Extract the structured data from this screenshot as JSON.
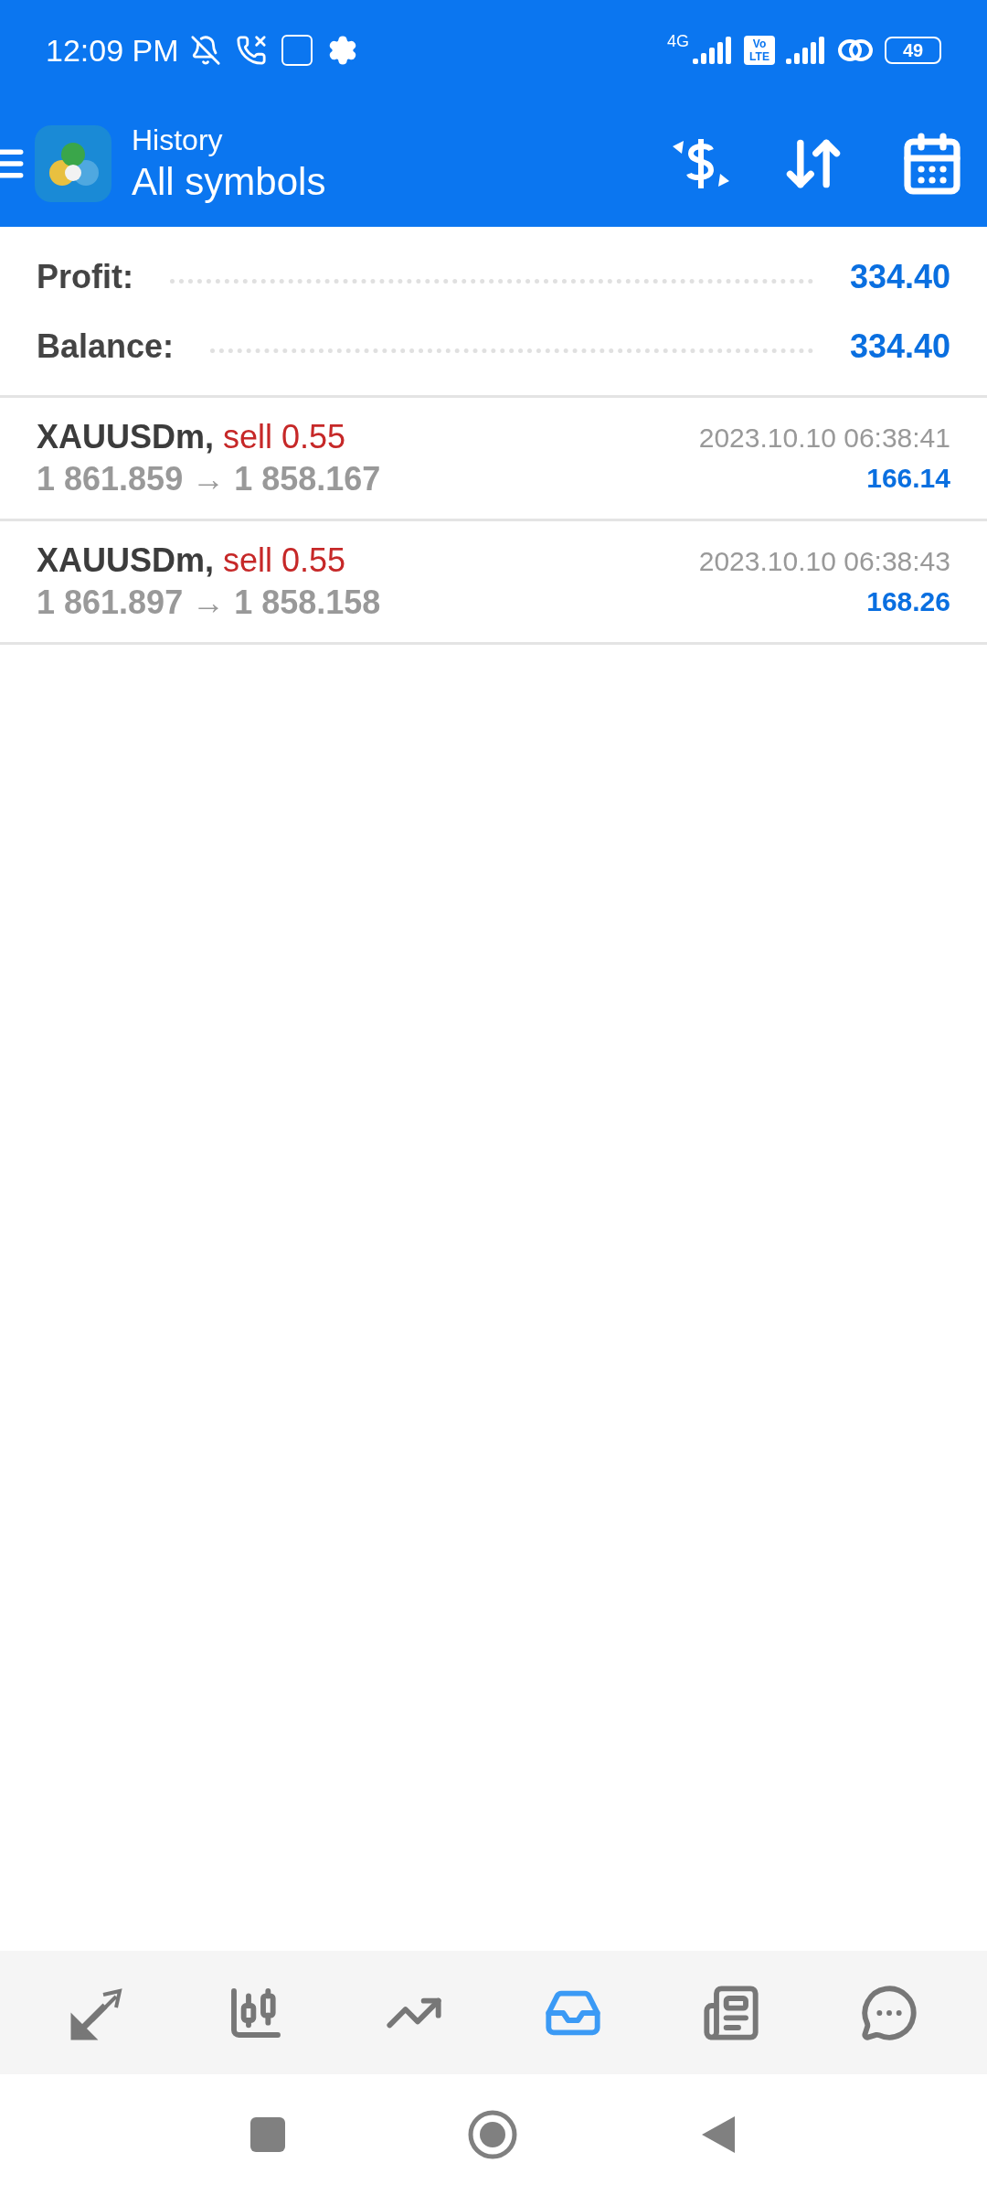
{
  "status_bar": {
    "time": "12:09 PM",
    "network": "4G",
    "volte": [
      "Vo",
      "LTE"
    ],
    "battery": "49"
  },
  "header": {
    "title": "History",
    "subtitle": "All symbols"
  },
  "summary": [
    {
      "label": "Profit:",
      "value": "334.40"
    },
    {
      "label": "Balance:",
      "value": "334.40"
    }
  ],
  "deals": [
    {
      "symbol": "XAUUSDm,",
      "type": "sell 0.55",
      "prices": "1 861.859 → 1 858.167",
      "time": "2023.10.10 06:38:41",
      "profit": "166.14"
    },
    {
      "symbol": "XAUUSDm,",
      "type": "sell 0.55",
      "prices": "1 861.897 → 1 858.158",
      "time": "2023.10.10 06:38:43",
      "profit": "168.26"
    }
  ],
  "bottom_nav": [
    {
      "selected": false
    },
    {
      "selected": false
    },
    {
      "selected": false
    },
    {
      "selected": true
    },
    {
      "selected": false
    },
    {
      "selected": false
    }
  ]
}
